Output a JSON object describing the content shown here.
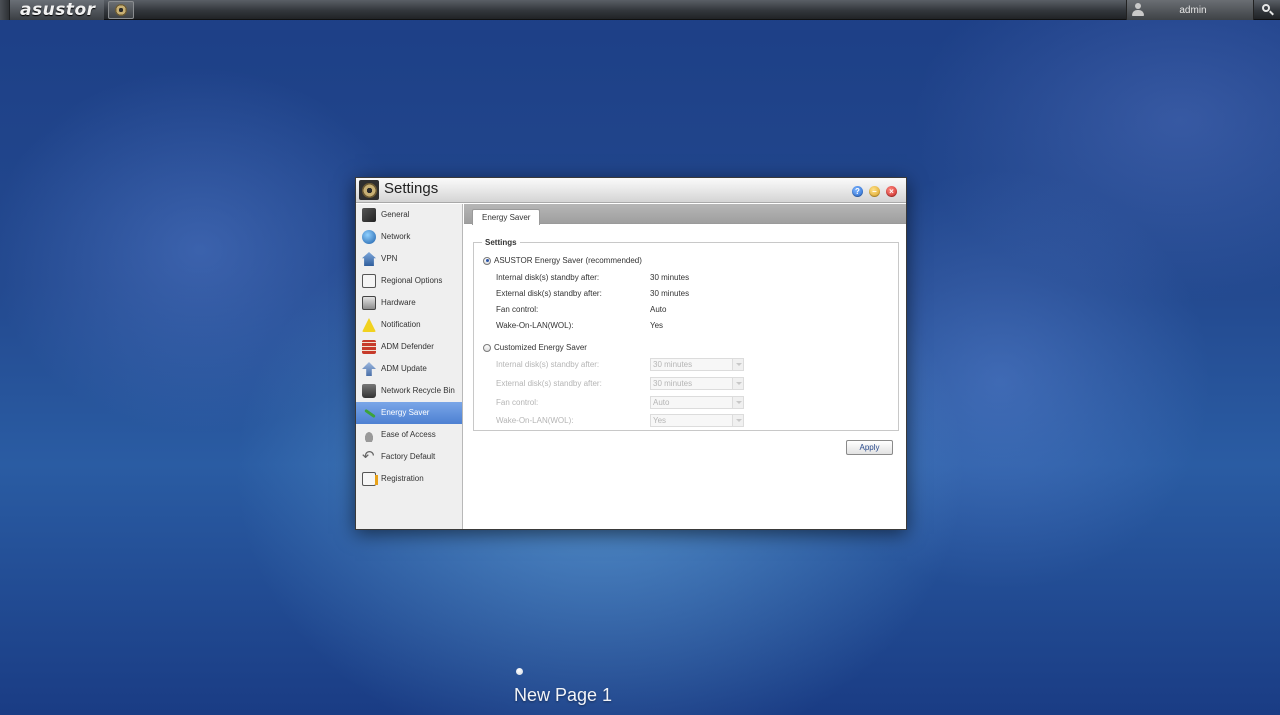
{
  "topbar": {
    "brand": "asustor",
    "user_name": "admin"
  },
  "window": {
    "title": "Settings"
  },
  "sidebar": {
    "items": [
      {
        "label": "General",
        "icon": "general-icon"
      },
      {
        "label": "Network",
        "icon": "network-globe-icon"
      },
      {
        "label": "VPN",
        "icon": "vpn-house-icon"
      },
      {
        "label": "Regional Options",
        "icon": "clock-icon"
      },
      {
        "label": "Hardware",
        "icon": "hardware-icon"
      },
      {
        "label": "Notification",
        "icon": "warning-icon"
      },
      {
        "label": "ADM Defender",
        "icon": "firewall-icon"
      },
      {
        "label": "ADM Update",
        "icon": "upload-arrow-icon"
      },
      {
        "label": "Network Recycle Bin",
        "icon": "trash-icon"
      },
      {
        "label": "Energy Saver",
        "icon": "leaf-icon"
      },
      {
        "label": "Ease of Access",
        "icon": "ease-access-icon"
      },
      {
        "label": "Factory Default",
        "icon": "undo-arrow-icon"
      },
      {
        "label": "Registration",
        "icon": "clipboard-icon"
      }
    ],
    "active_index": 9
  },
  "tabs": [
    {
      "label": "Energy Saver"
    }
  ],
  "settings_group": {
    "legend": "Settings",
    "recommended": {
      "label": "ASUSTOR Energy Saver (recommended)",
      "checked": true,
      "rows": [
        {
          "key": "Internal disk(s) standby after:",
          "value": "30 minutes"
        },
        {
          "key": "External disk(s) standby after:",
          "value": "30 minutes"
        },
        {
          "key": "Fan control:",
          "value": "Auto"
        },
        {
          "key": "Wake-On-LAN(WOL):",
          "value": "Yes"
        }
      ]
    },
    "custom": {
      "label": "Customized Energy Saver",
      "checked": false,
      "rows": [
        {
          "key": "Internal disk(s) standby after:",
          "value": "30 minutes"
        },
        {
          "key": "External disk(s) standby after:",
          "value": "30 minutes"
        },
        {
          "key": "Fan control:",
          "value": "Auto"
        },
        {
          "key": "Wake-On-LAN(WOL):",
          "value": "Yes"
        }
      ]
    }
  },
  "buttons": {
    "apply": "Apply"
  },
  "desktop": {
    "page_label": "New Page 1"
  }
}
